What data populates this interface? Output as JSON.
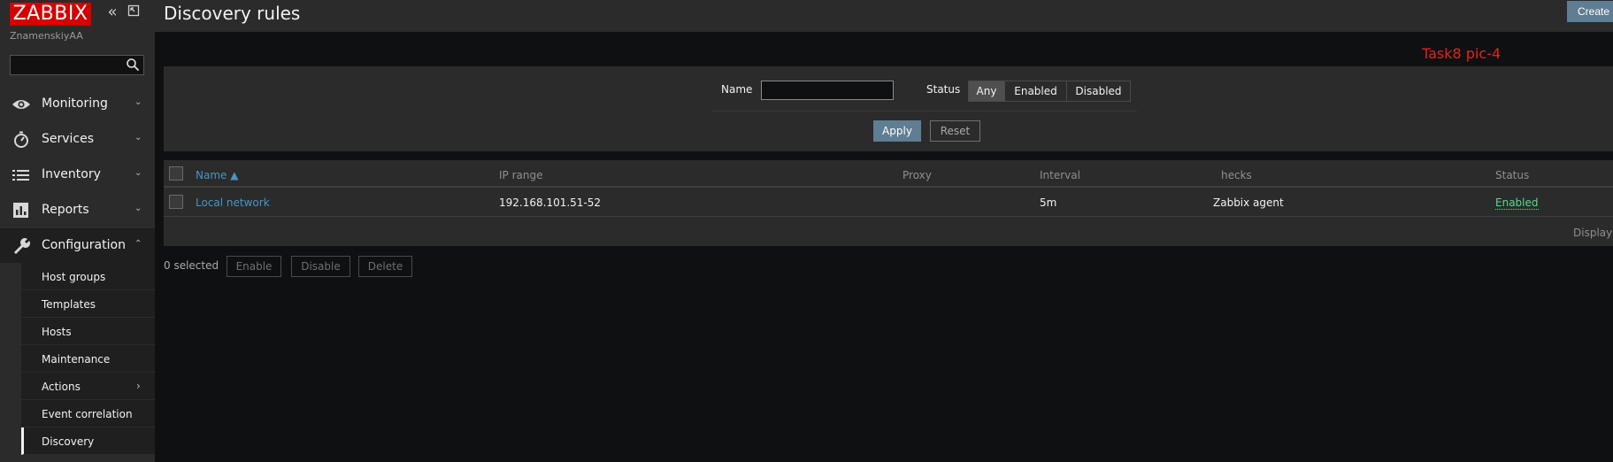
{
  "app": {
    "logo": "ZABBIX",
    "username": "ZnamenskiyAA"
  },
  "sidebar": {
    "search": {
      "value": "",
      "placeholder": ""
    },
    "menu": [
      {
        "label": "Monitoring",
        "icon": "eye-icon",
        "chevron": "⌄"
      },
      {
        "label": "Services",
        "icon": "clock-icon",
        "chevron": "⌄"
      },
      {
        "label": "Inventory",
        "icon": "list-icon",
        "chevron": "⌄"
      },
      {
        "label": "Reports",
        "icon": "bar-chart-icon",
        "chevron": "⌄"
      },
      {
        "label": "Configuration",
        "icon": "wrench-icon",
        "chevron": "⌃"
      }
    ],
    "submenu": [
      {
        "label": "Host groups"
      },
      {
        "label": "Templates"
      },
      {
        "label": "Hosts"
      },
      {
        "label": "Maintenance"
      },
      {
        "label": "Actions",
        "chevron": "›"
      },
      {
        "label": "Event correlation"
      },
      {
        "label": "Discovery",
        "active": true
      }
    ]
  },
  "header": {
    "title": "Discovery rules",
    "create_label": "Create"
  },
  "overlay_note": "Task8 pic-4",
  "filter": {
    "name_label": "Name",
    "name_value": "",
    "status_label": "Status",
    "status_options": [
      "Any",
      "Enabled",
      "Disabled"
    ],
    "status_selected": "Any",
    "apply_label": "Apply",
    "reset_label": "Reset"
  },
  "table": {
    "columns": [
      "Name ▲",
      "IP range",
      "Proxy",
      "Interval",
      "hecks",
      "Status"
    ],
    "rows": [
      {
        "name": "Local network",
        "ip_range": "192.168.101.51-52",
        "proxy": "",
        "interval": "5m",
        "checks": "Zabbix agent",
        "status": "Enabled"
      }
    ],
    "footer_text": "Displayin"
  },
  "actions": {
    "selected_text": "0 selected",
    "enable_label": "Enable",
    "disable_label": "Disable",
    "delete_label": "Delete"
  },
  "colors": {
    "accent": "#4796c4",
    "status_enabled": "#59db8f",
    "logo_bg": "#d40000",
    "button": "#5f7d93",
    "note": "#e0251c"
  }
}
